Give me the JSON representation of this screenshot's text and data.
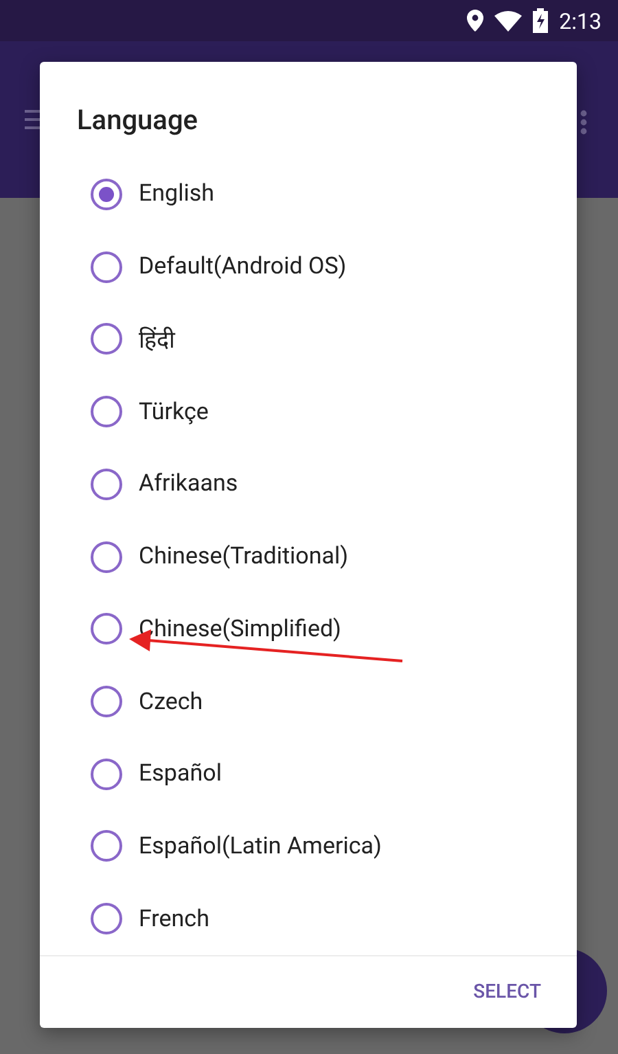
{
  "status_bar": {
    "time": "2:13"
  },
  "dialog": {
    "title": "Language",
    "options": [
      {
        "label": "English",
        "selected": true
      },
      {
        "label": "Default(Android OS)",
        "selected": false
      },
      {
        "label": "हिंदी",
        "selected": false
      },
      {
        "label": "Türkçe",
        "selected": false
      },
      {
        "label": "Afrikaans",
        "selected": false
      },
      {
        "label": "Chinese(Traditional)",
        "selected": false
      },
      {
        "label": "Chinese(Simplified)",
        "selected": false
      },
      {
        "label": "Czech",
        "selected": false
      },
      {
        "label": "Español",
        "selected": false
      },
      {
        "label": "Español(Latin America)",
        "selected": false
      },
      {
        "label": "French",
        "selected": false
      }
    ],
    "buttons": [
      "SELECT"
    ]
  }
}
